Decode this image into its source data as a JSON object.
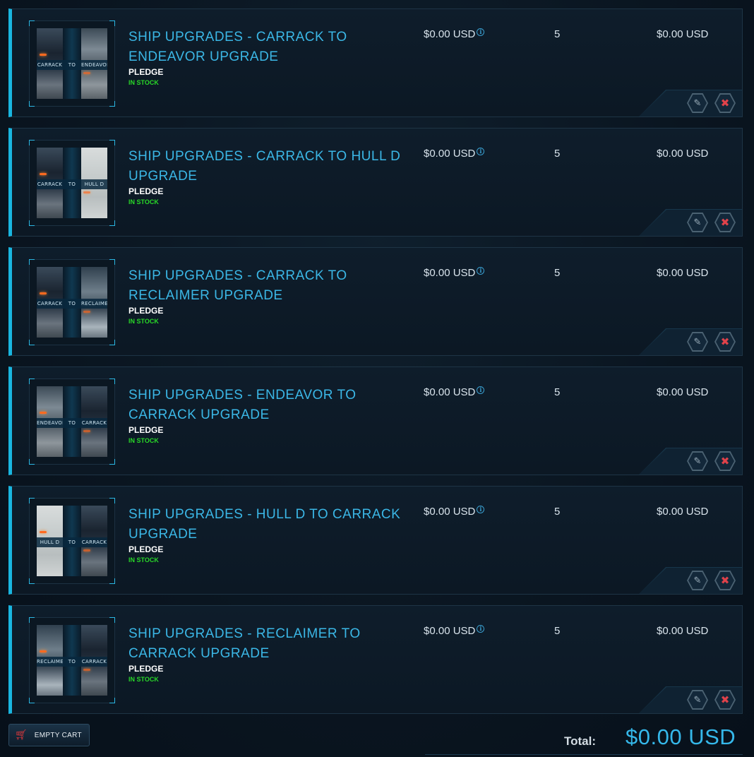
{
  "colors": {
    "accent": "#19b6e0",
    "title": "#3bb7e6",
    "in_stock": "#28d828",
    "remove": "#e0424a"
  },
  "items": [
    {
      "title": "SHIP UPGRADES - CARRACK TO ENDEAVOR UPGRADE",
      "type": "PLEDGE",
      "stock": "IN STOCK",
      "price": "$0.00 USD",
      "quantity": "5",
      "subtotal": "$0.00 USD",
      "thumb_from": "CARRACK",
      "thumb_to": "TO",
      "thumb_dest": "ENDEAVOR",
      "from_style": "img-dark",
      "dest_style": "img-grey"
    },
    {
      "title": "SHIP UPGRADES - CARRACK TO HULL D UPGRADE",
      "type": "PLEDGE",
      "stock": "IN STOCK",
      "price": "$0.00 USD",
      "quantity": "5",
      "subtotal": "$0.00 USD",
      "thumb_from": "CARRACK",
      "thumb_to": "TO",
      "thumb_dest": "HULL D",
      "from_style": "img-dark",
      "dest_style": "img-light"
    },
    {
      "title": "SHIP UPGRADES - CARRACK TO RECLAIMER UPGRADE",
      "type": "PLEDGE",
      "stock": "IN STOCK",
      "price": "$0.00 USD",
      "quantity": "5",
      "subtotal": "$0.00 USD",
      "thumb_from": "CARRACK",
      "thumb_to": "TO",
      "thumb_dest": "RECLAIMER",
      "from_style": "img-dark",
      "dest_style": "img-cloud"
    },
    {
      "title": "SHIP UPGRADES - ENDEAVOR TO CARRACK UPGRADE",
      "type": "PLEDGE",
      "stock": "IN STOCK",
      "price": "$0.00 USD",
      "quantity": "5",
      "subtotal": "$0.00 USD",
      "thumb_from": "ENDEAVOR",
      "thumb_to": "TO",
      "thumb_dest": "CARRACK",
      "from_style": "img-grey",
      "dest_style": "img-dark"
    },
    {
      "title": "SHIP UPGRADES - HULL D TO CARRACK UPGRADE",
      "type": "PLEDGE",
      "stock": "IN STOCK",
      "price": "$0.00 USD",
      "quantity": "5",
      "subtotal": "$0.00 USD",
      "thumb_from": "HULL D",
      "thumb_to": "TO",
      "thumb_dest": "CARRACK",
      "from_style": "img-light",
      "dest_style": "img-dark"
    },
    {
      "title": "SHIP UPGRADES - RECLAIMER TO CARRACK UPGRADE",
      "type": "PLEDGE",
      "stock": "IN STOCK",
      "price": "$0.00 USD",
      "quantity": "5",
      "subtotal": "$0.00 USD",
      "thumb_from": "RECLAIMER",
      "thumb_to": "TO",
      "thumb_dest": "CARRACK",
      "from_style": "img-cloud",
      "dest_style": "img-dark"
    }
  ],
  "icons": {
    "info": "info-icon",
    "edit": "pencil-icon",
    "remove": "close-icon",
    "cart": "cart-icon"
  },
  "footer": {
    "empty_cart_label": "EMPTY CART",
    "total_label": "Total:",
    "total_value": "$0.00 USD"
  }
}
